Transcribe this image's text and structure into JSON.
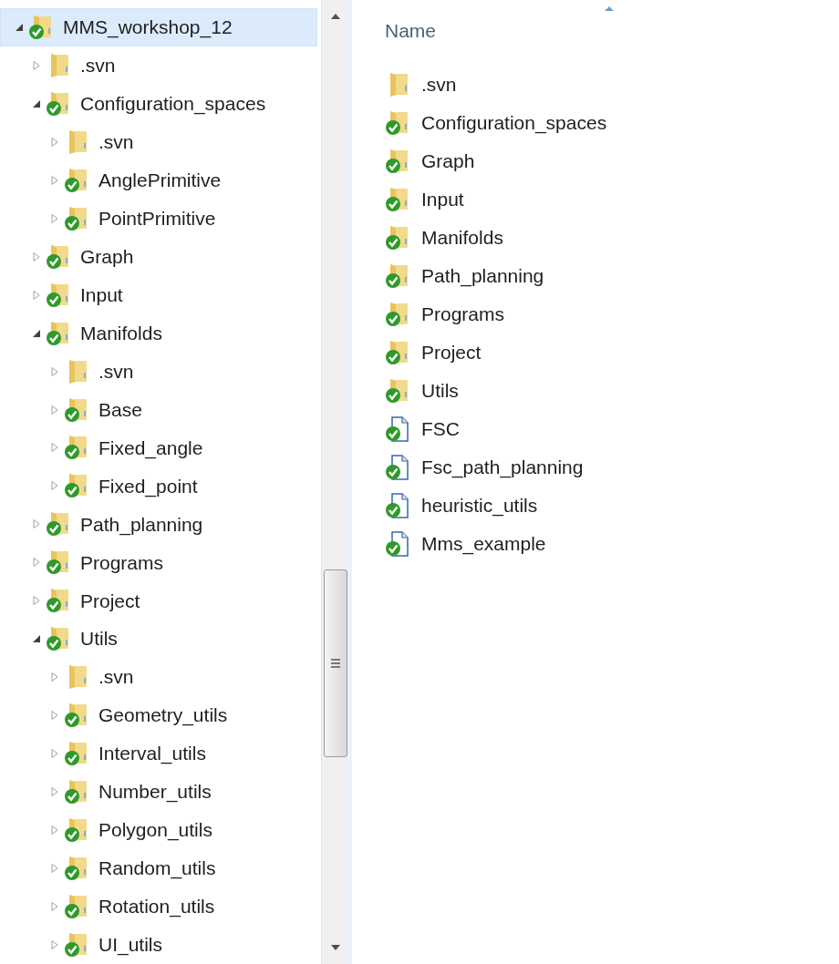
{
  "tree": [
    {
      "label": "MMS_workshop_12",
      "kind": "folder",
      "versioned": true,
      "expanded": true,
      "selected": true,
      "children": [
        {
          "label": ".svn",
          "kind": "folder",
          "versioned": false,
          "expanded": false,
          "selected": false
        },
        {
          "label": "Configuration_spaces",
          "kind": "folder",
          "versioned": true,
          "expanded": true,
          "selected": false,
          "children": [
            {
              "label": ".svn",
              "kind": "folder",
              "versioned": false,
              "expanded": false,
              "selected": false
            },
            {
              "label": "AnglePrimitive",
              "kind": "folder",
              "versioned": true,
              "expanded": false,
              "selected": false
            },
            {
              "label": "PointPrimitive",
              "kind": "folder",
              "versioned": true,
              "expanded": false,
              "selected": false
            }
          ]
        },
        {
          "label": "Graph",
          "kind": "folder",
          "versioned": true,
          "expanded": false,
          "selected": false
        },
        {
          "label": "Input",
          "kind": "folder",
          "versioned": true,
          "expanded": false,
          "selected": false
        },
        {
          "label": "Manifolds",
          "kind": "folder",
          "versioned": true,
          "expanded": true,
          "selected": false,
          "children": [
            {
              "label": ".svn",
              "kind": "folder",
              "versioned": false,
              "expanded": false,
              "selected": false
            },
            {
              "label": "Base",
              "kind": "folder",
              "versioned": true,
              "expanded": false,
              "selected": false
            },
            {
              "label": "Fixed_angle",
              "kind": "folder",
              "versioned": true,
              "expanded": false,
              "selected": false
            },
            {
              "label": "Fixed_point",
              "kind": "folder",
              "versioned": true,
              "expanded": false,
              "selected": false
            }
          ]
        },
        {
          "label": "Path_planning",
          "kind": "folder",
          "versioned": true,
          "expanded": false,
          "selected": false
        },
        {
          "label": "Programs",
          "kind": "folder",
          "versioned": true,
          "expanded": false,
          "selected": false
        },
        {
          "label": "Project",
          "kind": "folder",
          "versioned": true,
          "expanded": false,
          "selected": false
        },
        {
          "label": "Utils",
          "kind": "folder",
          "versioned": true,
          "expanded": true,
          "selected": false,
          "children": [
            {
              "label": ".svn",
              "kind": "folder",
              "versioned": false,
              "expanded": false,
              "selected": false
            },
            {
              "label": "Geometry_utils",
              "kind": "folder",
              "versioned": true,
              "expanded": false,
              "selected": false
            },
            {
              "label": "Interval_utils",
              "kind": "folder",
              "versioned": true,
              "expanded": false,
              "selected": false
            },
            {
              "label": "Number_utils",
              "kind": "folder",
              "versioned": true,
              "expanded": false,
              "selected": false
            },
            {
              "label": "Polygon_utils",
              "kind": "folder",
              "versioned": true,
              "expanded": false,
              "selected": false
            },
            {
              "label": "Random_utils",
              "kind": "folder",
              "versioned": true,
              "expanded": false,
              "selected": false
            },
            {
              "label": "Rotation_utils",
              "kind": "folder",
              "versioned": true,
              "expanded": false,
              "selected": false
            },
            {
              "label": "UI_utils",
              "kind": "folder",
              "versioned": true,
              "expanded": false,
              "selected": false
            }
          ]
        }
      ]
    }
  ],
  "file_list": {
    "column_header": "Name",
    "items": [
      {
        "name": ".svn",
        "kind": "folder",
        "versioned": false
      },
      {
        "name": "Configuration_spaces",
        "kind": "folder",
        "versioned": true
      },
      {
        "name": "Graph",
        "kind": "folder",
        "versioned": true
      },
      {
        "name": "Input",
        "kind": "folder",
        "versioned": true
      },
      {
        "name": "Manifolds",
        "kind": "folder",
        "versioned": true
      },
      {
        "name": "Path_planning",
        "kind": "folder",
        "versioned": true
      },
      {
        "name": "Programs",
        "kind": "folder",
        "versioned": true
      },
      {
        "name": "Project",
        "kind": "folder",
        "versioned": true
      },
      {
        "name": "Utils",
        "kind": "folder",
        "versioned": true
      },
      {
        "name": "FSC",
        "kind": "file",
        "versioned": true
      },
      {
        "name": "Fsc_path_planning",
        "kind": "file",
        "versioned": true
      },
      {
        "name": "heuristic_utils",
        "kind": "file",
        "versioned": true
      },
      {
        "name": "Mms_example",
        "kind": "file",
        "versioned": true
      }
    ]
  }
}
